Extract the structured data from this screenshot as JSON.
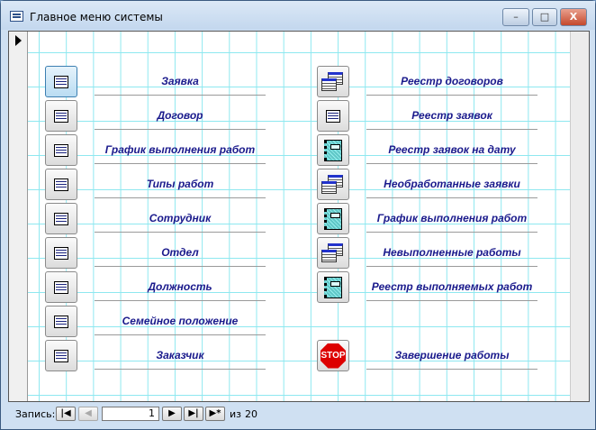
{
  "window": {
    "title": "Главное меню системы",
    "minimize": "–",
    "maximize": "□",
    "close": "X"
  },
  "left_items": [
    {
      "label": "Заявка",
      "icon": "form-icon"
    },
    {
      "label": "Договор",
      "icon": "form-icon"
    },
    {
      "label": "График выполнения работ",
      "icon": "form-icon"
    },
    {
      "label": "Типы работ",
      "icon": "form-icon"
    },
    {
      "label": "Сотрудник",
      "icon": "form-icon"
    },
    {
      "label": "Отдел",
      "icon": "form-icon"
    },
    {
      "label": "Должность",
      "icon": "form-icon"
    },
    {
      "label": "Семейное положение",
      "icon": "form-icon"
    },
    {
      "label": "Заказчик",
      "icon": "form-icon"
    }
  ],
  "right_items": [
    {
      "label": "Реестр договоров",
      "icon": "table-icon"
    },
    {
      "label": "Реестр заявок",
      "icon": "form-icon"
    },
    {
      "label": "Реестр заявок на дату",
      "icon": "report-icon"
    },
    {
      "label": "Необработанные заявки",
      "icon": "table-icon"
    },
    {
      "label": "График выполнения работ",
      "icon": "report-icon"
    },
    {
      "label": "Невыполненные работы",
      "icon": "table-icon"
    },
    {
      "label": "Реестр выполняемых работ",
      "icon": "report-icon"
    }
  ],
  "exit": {
    "label": "Завершение работы",
    "icon_text": "STOP"
  },
  "navigator": {
    "label": "Запись:",
    "current": "1",
    "of_label": "из",
    "total": "20"
  }
}
